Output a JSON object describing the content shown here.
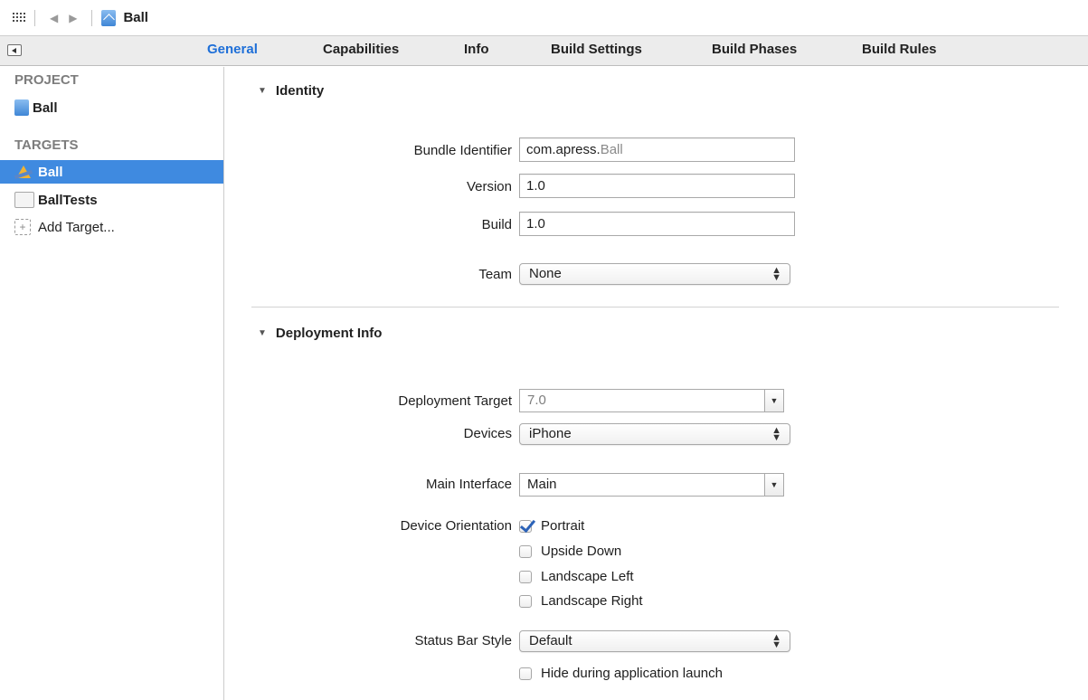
{
  "jumpbar": {
    "title": "Ball",
    "back": "◀",
    "forward": "▶"
  },
  "tabs": [
    {
      "label": "General",
      "active": true
    },
    {
      "label": "Capabilities",
      "active": false
    },
    {
      "label": "Info",
      "active": false
    },
    {
      "label": "Build Settings",
      "active": false
    },
    {
      "label": "Build Phases",
      "active": false
    },
    {
      "label": "Build Rules",
      "active": false
    }
  ],
  "sidebar": {
    "project_heading": "PROJECT",
    "project_item": "Ball",
    "targets_heading": "TARGETS",
    "targets": [
      {
        "label": "Ball",
        "selected": true
      },
      {
        "label": "BallTests",
        "selected": false
      }
    ],
    "add_target": "Add Target...",
    "add_icon": "+"
  },
  "identity": {
    "heading": "Identity",
    "bundle_label": "Bundle Identifier",
    "bundle_prefix": "com.apress.",
    "bundle_suffix": "Ball",
    "version_label": "Version",
    "version_value": "1.0",
    "build_label": "Build",
    "build_value": "1.0",
    "team_label": "Team",
    "team_value": "None"
  },
  "deployment": {
    "heading": "Deployment Info",
    "target_label": "Deployment Target",
    "target_value": "7.0",
    "devices_label": "Devices",
    "devices_value": "iPhone",
    "main_interface_label": "Main Interface",
    "main_interface_value": "Main",
    "orientation_label": "Device Orientation",
    "orientations": [
      {
        "label": "Portrait",
        "checked": true
      },
      {
        "label": "Upside Down",
        "checked": false
      },
      {
        "label": "Landscape Left",
        "checked": false
      },
      {
        "label": "Landscape Right",
        "checked": false
      }
    ],
    "status_bar_label": "Status Bar Style",
    "status_bar_value": "Default",
    "hide_status_label": "Hide during application launch",
    "hide_status_checked": false
  },
  "icons": {
    "triangle": "▼",
    "updown_up": "▲",
    "updown_down": "▼",
    "drop": "▼"
  },
  "colors": {
    "accent": "#1e6fd8",
    "selection": "#3f8ae0"
  }
}
